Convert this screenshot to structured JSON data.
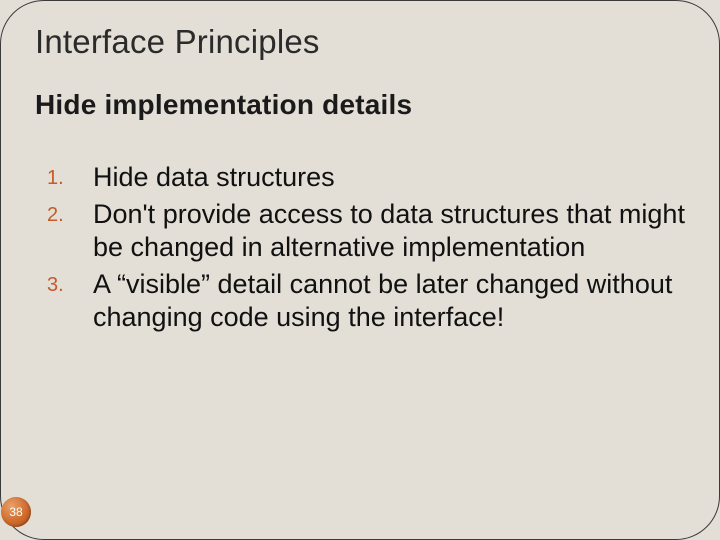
{
  "slide": {
    "title": "Interface Principles",
    "subtitle": "Hide implementation details",
    "points": [
      {
        "num": "1.",
        "text": "Hide data structures"
      },
      {
        "num": "2.",
        "text": "Don't provide access to data structures that might be changed in alternative implementation"
      },
      {
        "num": "3.",
        "text": "A “visible” detail cannot be later changed without changing code using the interface!"
      }
    ],
    "page_number": "38"
  }
}
